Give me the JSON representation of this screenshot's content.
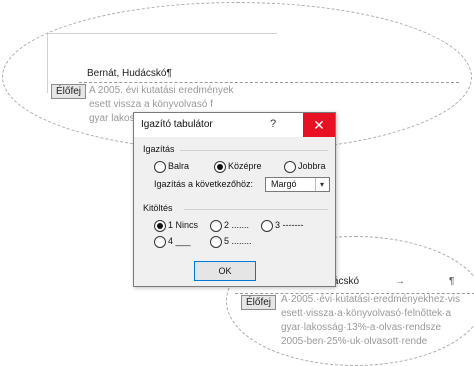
{
  "top_magnifier": {
    "header_author_text": "Bernát, Hudácskó¶",
    "header_tag": "Élőfej",
    "body_lines": [
      "A 2005. évi kutatási eredmények",
      "esett vissza a könyvolvasó f",
      "gyar lakossá"
    ]
  },
  "dialog": {
    "title": "Igazító tabulátor",
    "help_symbol": "?",
    "close_symbol": "✕",
    "alignment": {
      "group_label": "Igazítás",
      "options": [
        "Balra",
        "Középre",
        "Jobbra"
      ],
      "selected": "Középre"
    },
    "align_to_label": "Igazítás a következőhöz:",
    "align_to_value": "Margó",
    "leader": {
      "group_label": "Kitöltés",
      "options": [
        "1 Nincs",
        "2 .......",
        "3 -------",
        "4 ___",
        "5 ........"
      ],
      "selected": "1 Nincs"
    },
    "ok_label": "OK"
  },
  "bottom_magnifier": {
    "header_author_text": "Bernát,·Hudácskó",
    "tab_arrow": "→",
    "pilcrow": "¶",
    "header_tag": "Élőfej",
    "body_lines": [
      "A·2005.·évi·kutatási·eredményekhez·vis",
      "esett·vissza·a·könyvolvasó·felnőttek·a",
      "gyar·lakosság·13%-a·olvas·rendsze",
      "2005-ben·25%-uk·olvasott·rende"
    ]
  }
}
